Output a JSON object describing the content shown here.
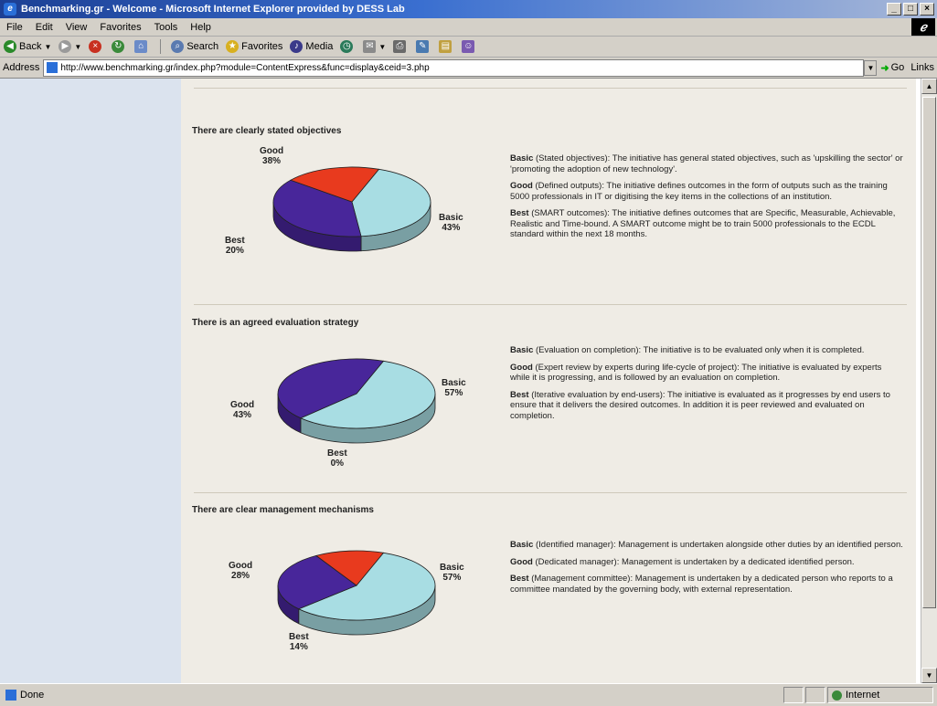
{
  "window": {
    "title": "Benchmarking.gr - Welcome - Microsoft Internet Explorer provided by DESS Lab",
    "min": "_",
    "max": "□",
    "close": "×"
  },
  "menu": [
    "File",
    "Edit",
    "View",
    "Favorites",
    "Tools",
    "Help"
  ],
  "toolbar": {
    "back": "Back",
    "search": "Search",
    "favorites": "Favorites",
    "media": "Media"
  },
  "address": {
    "label": "Address",
    "url": "http://www.benchmarking.gr/index.php?module=ContentExpress&func=display&ceid=3.php",
    "go": "Go",
    "links": "Links"
  },
  "sections": [
    {
      "heading": "There are clearly stated objectives",
      "labels": {
        "good": "Good",
        "good_val": "38%",
        "basic": "Basic",
        "basic_val": "43%",
        "best": "Best",
        "best_val": "20%"
      },
      "descs": [
        {
          "term": "Basic",
          "text": " (Stated objectives): The initiative has general stated objectives, such as 'upskilling the sector' or 'promoting the adoption of new technology'."
        },
        {
          "term": "Good",
          "text": " (Defined outputs): The initiative defines outcomes in the form of outputs such as the training 5000 professionals in IT or digitising the key items in the collections of an institution."
        },
        {
          "term": "Best",
          "text": " (SMART outcomes): The initiative defines outcomes that are Specific, Measurable, Achievable, Realistic and Time-bound. A SMART outcome might be to train 5000 professionals to the ECDL standard within the next 18 months."
        }
      ]
    },
    {
      "heading": "There is an agreed evaluation strategy",
      "labels": {
        "good": "Good",
        "good_val": "43%",
        "basic": "Basic",
        "basic_val": "57%",
        "best": "Best",
        "best_val": "0%"
      },
      "descs": [
        {
          "term": "Basic",
          "text": " (Evaluation on completion): The initiative is to be evaluated only when it is completed."
        },
        {
          "term": "Good",
          "text": " (Expert review by experts during life-cycle of project): The initiative is evaluated by experts while it is progressing, and is followed by an evaluation on completion."
        },
        {
          "term": "Best",
          "text": " (Iterative evaluation by end-users): The initiative is evaluated as it progresses by end users to ensure that it delivers the desired outcomes. In addition it is peer reviewed and evaluated on completion."
        }
      ]
    },
    {
      "heading": "There are clear management mechanisms",
      "labels": {
        "good": "Good",
        "good_val": "28%",
        "basic": "Basic",
        "basic_val": "57%",
        "best": "Best",
        "best_val": "14%"
      },
      "descs": [
        {
          "term": "Basic",
          "text": " (Identified manager): Management is undertaken alongside other duties by an identified person."
        },
        {
          "term": "Good",
          "text": " (Dedicated manager): Management is undertaken by a dedicated identified person."
        },
        {
          "term": "Best",
          "text": " (Management committee): Management is undertaken by a dedicated person who reports to a committee mandated by the governing body, with external representation."
        }
      ]
    }
  ],
  "chart_data": [
    {
      "type": "pie",
      "title": "There are clearly stated objectives",
      "categories": [
        "Basic",
        "Good",
        "Best"
      ],
      "values": [
        43,
        38,
        20
      ],
      "colors": [
        "#a8dde3",
        "#48269a",
        "#e83a1e"
      ]
    },
    {
      "type": "pie",
      "title": "There is an agreed evaluation strategy",
      "categories": [
        "Basic",
        "Good",
        "Best"
      ],
      "values": [
        57,
        43,
        0
      ],
      "colors": [
        "#a8dde3",
        "#48269a",
        "#e83a1e"
      ]
    },
    {
      "type": "pie",
      "title": "There are clear management mechanisms",
      "categories": [
        "Basic",
        "Good",
        "Best"
      ],
      "values": [
        57,
        28,
        14
      ],
      "colors": [
        "#a8dde3",
        "#48269a",
        "#e83a1e"
      ]
    }
  ],
  "status": {
    "text": "Done",
    "zone": "Internet"
  }
}
